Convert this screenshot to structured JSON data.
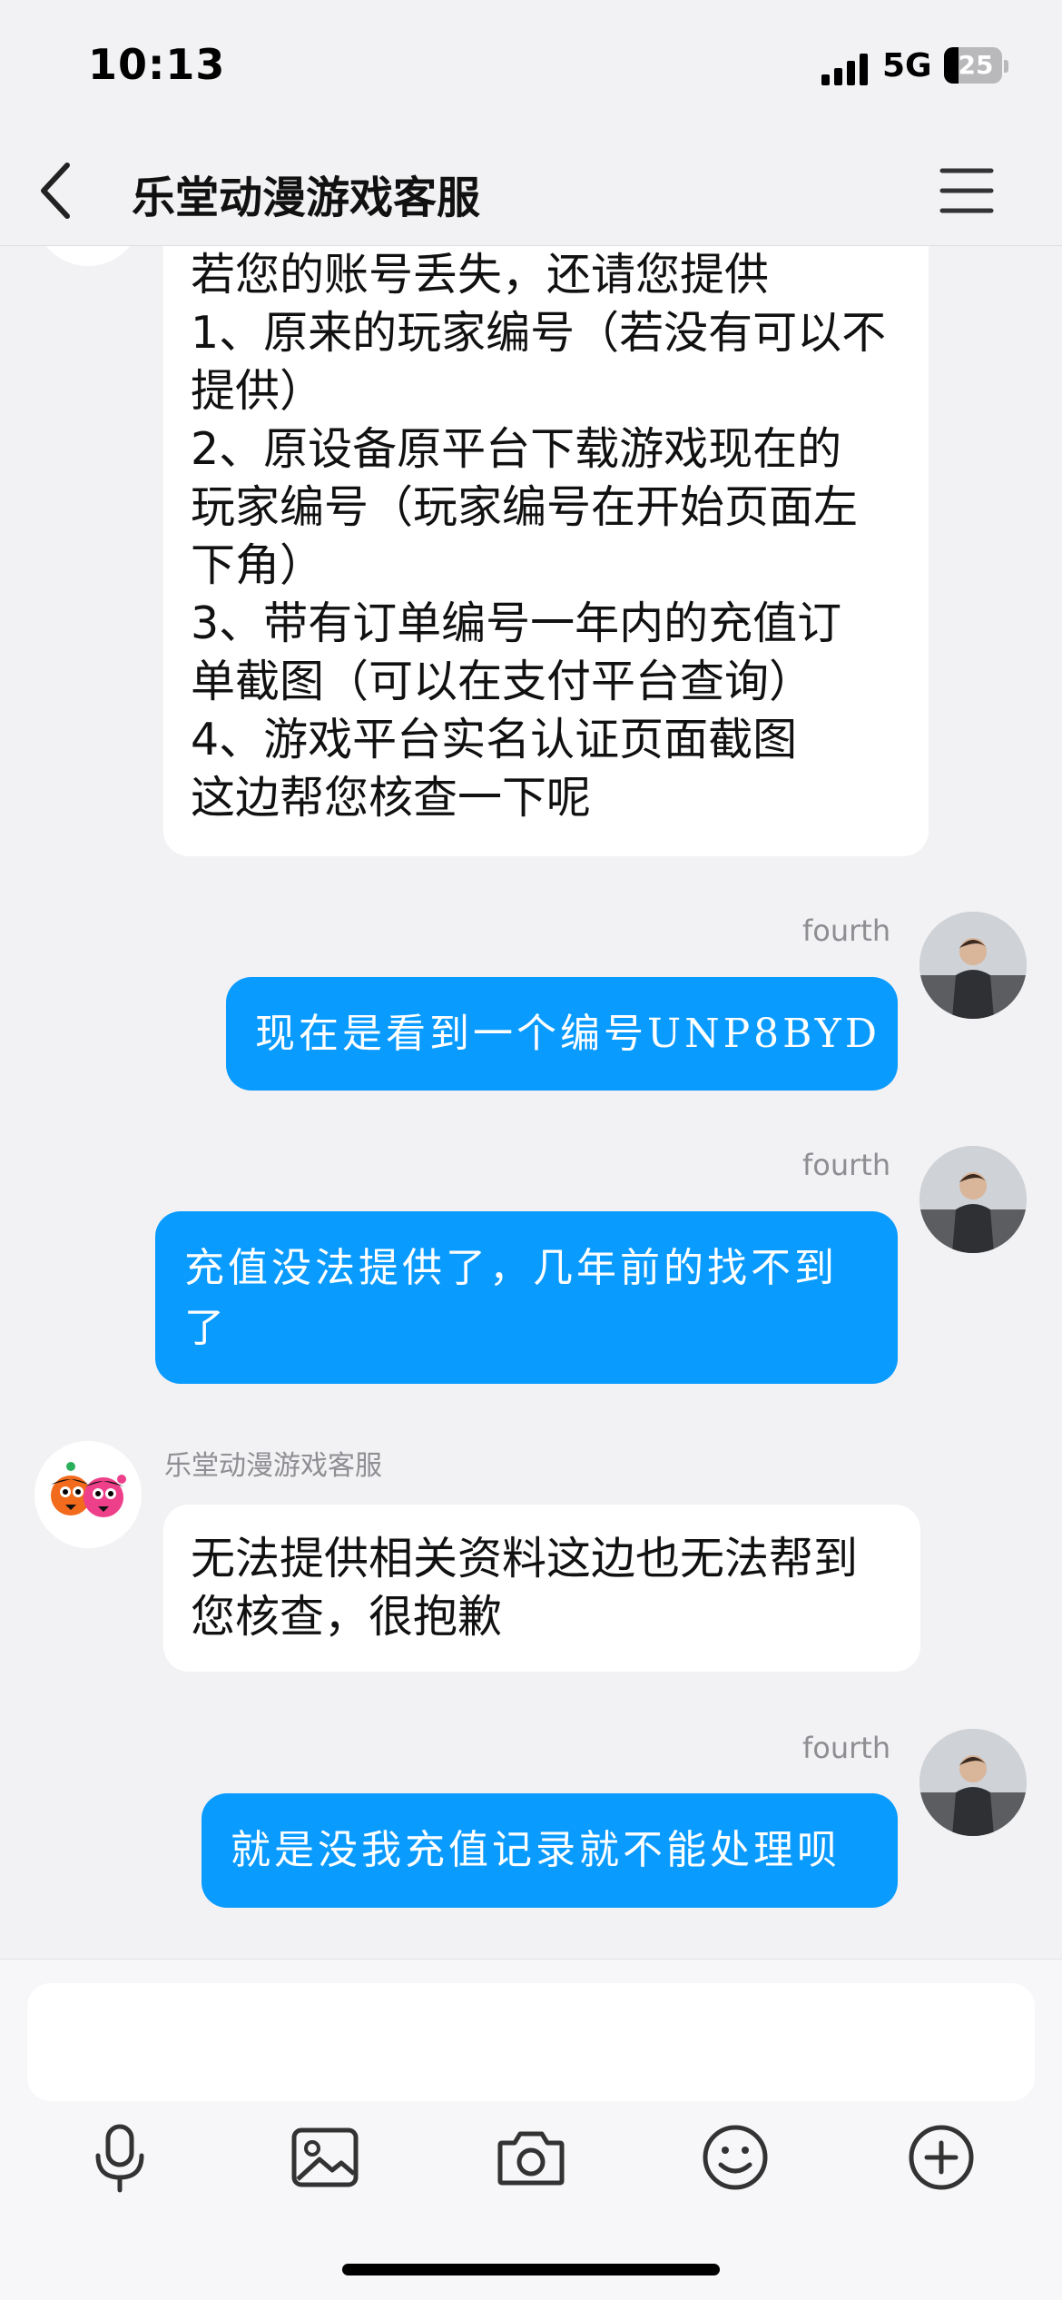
{
  "status_bar": {
    "time": "10:13",
    "network": "5G",
    "battery_level": "25"
  },
  "header": {
    "title": "乐堂动漫游戏客服"
  },
  "messages": [
    {
      "lines": [
        "若您的账号丢失，还请您提供",
        "1、原来的玩家编号（若没有可以不",
        "提供）",
        "2、原设备原平台下载游戏现在的",
        "玩家编号（玩家编号在开始页面左",
        "下角）",
        "3、带有订单编号一年内的充值订",
        "单截图（可以在支付平台查询）",
        "4、游戏平台实名认证页面截图",
        "这边帮您核查一下呢"
      ]
    },
    {
      "sender": "fourth",
      "lines": [
        "现在是看到一个编号UNP8BYD"
      ]
    },
    {
      "sender": "fourth",
      "lines": [
        "充值没法提供了，几年前的找不到",
        "了"
      ]
    },
    {
      "sender": "乐堂动漫游戏客服",
      "lines": [
        "无法提供相关资料这边也无法帮到",
        "您核查，很抱歉"
      ]
    },
    {
      "sender": "fourth",
      "lines": [
        "就是没我充值记录就不能处理呗"
      ]
    }
  ],
  "input": {
    "value": "",
    "placeholder": ""
  },
  "toolbar": {
    "icons": [
      "microphone-icon",
      "image-icon",
      "camera-icon",
      "emoji-icon",
      "plus-icon"
    ]
  },
  "colors": {
    "sent_bubble": "#0a9bff",
    "received_bubble": "#ffffff",
    "background": "#f2f2f4"
  }
}
